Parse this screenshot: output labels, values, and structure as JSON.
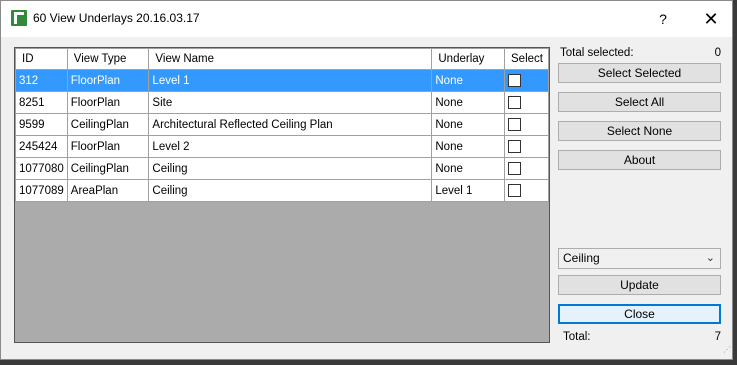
{
  "window": {
    "title": "60 View Underlays 20.16.03.17",
    "help_label": "?",
    "close_label": "✕"
  },
  "grid": {
    "columns": [
      "ID",
      "View Type",
      "View Name",
      "Underlay",
      "Select"
    ],
    "rows": [
      {
        "id": "312",
        "view_type": "FloorPlan",
        "view_name": "Level 1",
        "underlay": "None",
        "selected": false
      },
      {
        "id": "8251",
        "view_type": "FloorPlan",
        "view_name": "Site",
        "underlay": "None",
        "selected": false
      },
      {
        "id": "9599",
        "view_type": "CeilingPlan",
        "view_name": "Architectural Reflected Ceiling Plan",
        "underlay": "None",
        "selected": false
      },
      {
        "id": "245424",
        "view_type": "FloorPlan",
        "view_name": "Level 2",
        "underlay": "None",
        "selected": false
      },
      {
        "id": "1077080",
        "view_type": "CeilingPlan",
        "view_name": "Ceiling",
        "underlay": "None",
        "selected": false
      },
      {
        "id": "1077089",
        "view_type": "AreaPlan",
        "view_name": "Ceiling",
        "underlay": "Level 1",
        "selected": false
      }
    ]
  },
  "side": {
    "total_selected_label": "Total selected:",
    "total_selected_value": "0",
    "select_selected_label": "Select Selected",
    "select_all_label": "Select All",
    "select_none_label": "Select None",
    "about_label": "About",
    "underlay_select_value": "Ceiling",
    "update_label": "Update",
    "close_label": "Close",
    "total_label": "Total:",
    "total_value": "7"
  },
  "colors": {
    "selection": "#3399ff",
    "grid_background": "#ababab",
    "accent_border": "#0078d7"
  }
}
